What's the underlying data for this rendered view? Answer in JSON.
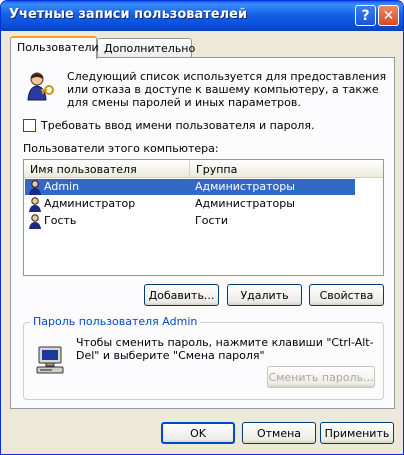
{
  "window": {
    "title": "Учетные записи пользователей",
    "help_label": "?",
    "close_label": "✕"
  },
  "tabs": [
    {
      "label": "Пользователи",
      "active": true
    },
    {
      "label": "Дополнительно",
      "active": false
    }
  ],
  "intro_text": "Следующий список используется для предоставления или отказа в доступе к вашему компьютеру, а также для смены паролей и иных параметров.",
  "require_login": {
    "label": "Требовать ввод имени пользователя и пароля.",
    "checked": false
  },
  "users_list": {
    "label": "Пользователи этого компьютера:",
    "columns": [
      "Имя пользователя",
      "Группа"
    ],
    "rows": [
      {
        "name": "Admin",
        "group": "Администраторы",
        "selected": true
      },
      {
        "name": "Администратор",
        "group": "Администраторы",
        "selected": false
      },
      {
        "name": "Гость",
        "group": "Гости",
        "selected": false
      }
    ]
  },
  "list_buttons": {
    "add": "Добавить...",
    "remove": "Удалить",
    "properties": "Свойства"
  },
  "password_group": {
    "title": "Пароль пользователя Admin",
    "text": "Чтобы сменить пароль, нажмите клавиши \"Ctrl-Alt-Del\" и выберите \"Смена пароля\"",
    "change_button": "Сменить пароль..."
  },
  "dialog_buttons": {
    "ok": "OK",
    "cancel": "Отмена",
    "apply": "Применить"
  },
  "colors": {
    "title_bar": "#0a50d8",
    "selection": "#316ac5",
    "group_title": "#0046d5",
    "tab_highlight": "#f5a018"
  }
}
